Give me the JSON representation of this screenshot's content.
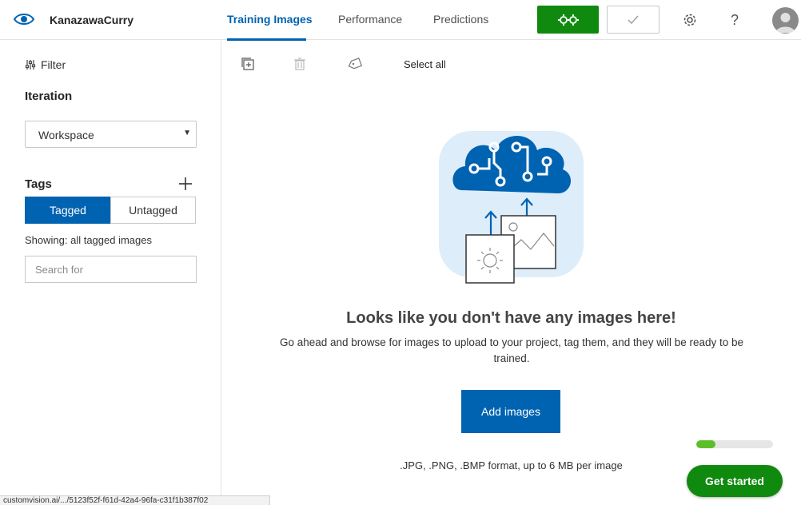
{
  "header": {
    "project_name": "KanazawaCurry",
    "tabs": [
      {
        "label": "Training Images",
        "active": true
      },
      {
        "label": "Performance",
        "active": false
      },
      {
        "label": "Predictions",
        "active": false
      }
    ],
    "train_icon": "gears-icon",
    "quick_test_icon": "check-icon",
    "settings_icon": "gear-icon",
    "help_label": "?",
    "accent_color": "#0063b1",
    "train_color": "#0f8a0f"
  },
  "sidebar": {
    "filter_label": "Filter",
    "iteration_title": "Iteration",
    "iteration_selected": "Workspace",
    "tags_title": "Tags",
    "tagged_label": "Tagged",
    "untagged_label": "Untagged",
    "showing_text": "Showing: all tagged images",
    "search_placeholder": "Search for"
  },
  "toolbar": {
    "add_icon": "add-image-icon",
    "delete_icon": "trash-icon",
    "tag_icon": "tag-icon",
    "select_all_label": "Select all"
  },
  "empty_state": {
    "title": "Looks like you don't have any images here!",
    "description": "Go ahead and browse for images to upload to your project, tag them, and they will be ready to be trained.",
    "add_images_label": "Add images",
    "format_note": ".JPG, .PNG, .BMP format, up to 6 MB per image"
  },
  "onboarding": {
    "progress": 0.25,
    "get_started_label": "Get started"
  },
  "status_bar": {
    "url": "customvision.ai/.../5123f52f-f61d-42a4-96fa-c31f1b387f02"
  }
}
